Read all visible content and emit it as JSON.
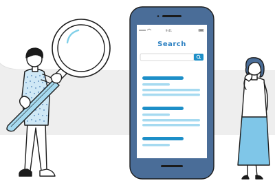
{
  "phone": {
    "time": "9:41",
    "search_title": "Search"
  },
  "colors": {
    "band": "#eeeeee",
    "phone_body": "#4a6d98",
    "accent_blue": "#1d8fc8",
    "light_blue": "#a6daf0",
    "skirt_blue": "#7fc6e8",
    "outline": "#1b1b1b"
  },
  "icons": [
    "magnifying-glass-icon",
    "search-icon",
    "wifi-icon",
    "battery-icon"
  ]
}
